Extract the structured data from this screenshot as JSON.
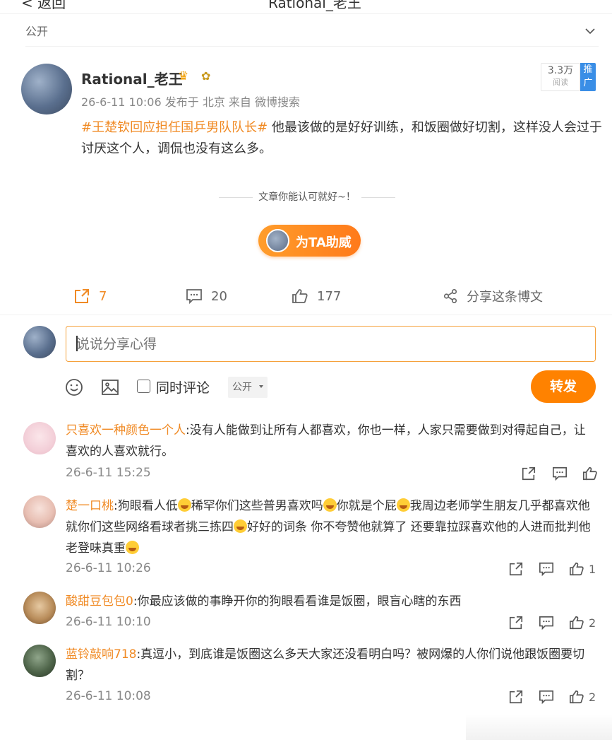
{
  "topbar": {
    "back_label": "< 返回",
    "title": "Rational_老王"
  },
  "visibility": {
    "label": "公开"
  },
  "post": {
    "author": "Rational_老王",
    "meta": "26-6-11 10:06 发布于 北京 来自 微博搜索",
    "reads_count": "3.3万",
    "reads_unit": "阅读",
    "promo_label": "推广",
    "hashtag": "#王楚钦回应担任国乒男队队长#",
    "body": " 他最该做的是好好训练，和饭圈做好切割，这样没人会过于讨厌这个人，调侃也没有这么多。",
    "divider_text": "文章你能认可就好~！",
    "boost_label": "为TA助威"
  },
  "actions": {
    "forward_count": "7",
    "comment_count": "20",
    "like_count": "177",
    "share_label": "分享这条博文"
  },
  "composer": {
    "placeholder": "说说分享心得",
    "also_comment_label": "同时评论",
    "visibility_option": "公开",
    "submit_label": "转发"
  },
  "comments": [
    {
      "name": "只喜欢一种颜色一个人",
      "text": ":没有人能做到让所有人都喜欢，你也一样，人家只需要做到对得起自己，让喜欢的人喜欢就行。",
      "time": "26-6-11 15:25",
      "likes": ""
    },
    {
      "name": "楚一口桃",
      "text_parts": [
        ":狗眼看人低",
        "稀罕你们这些普男喜欢吗",
        "你就是个屁",
        "我周边老师学生朋友几乎都喜欢他 就你们这些网络看球者挑三拣四",
        "好好的词条 你不夸赞他就算了 还要靠拉踩喜欢他的人进而批判他 老登味真重",
        ""
      ],
      "time": "26-6-11 10:26",
      "likes": "1"
    },
    {
      "name": "酸甜豆包包0",
      "text": ":你最应该做的事睁开你的狗眼看看谁是饭圈，眼盲心瞎的东西",
      "time": "26-6-11 10:10",
      "likes": "2"
    },
    {
      "name": "蓝铃敲响718",
      "text": ":真逗小，到底谁是饭圈这么多天大家还没看明白吗？被网爆的人你们说他跟饭圈要切割？",
      "time": "26-6-11 10:08",
      "likes": "2"
    }
  ],
  "icons": {
    "chevron": "chevron-down-icon",
    "forward": "forward-icon",
    "comment": "comment-icon",
    "like": "thumbs-up-icon",
    "share": "share-icon",
    "emoji": "emoji-icon",
    "image": "image-icon",
    "emoticon": "laugh-cry-emoticon"
  },
  "colors": {
    "accent": "#ff8200",
    "link": "#f08a24",
    "promo": "#3a8ee6"
  }
}
